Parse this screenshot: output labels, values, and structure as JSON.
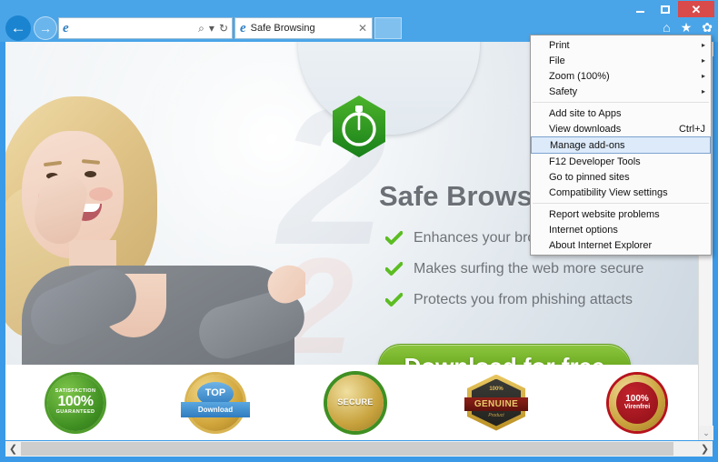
{
  "window": {
    "minimize_label": "",
    "maximize_label": "",
    "close_label": "✕"
  },
  "toolbar": {
    "back_icon": "←",
    "forward_icon": "→",
    "address_value": "",
    "address_placeholder": "",
    "search_icon": "⌕",
    "dropdown_icon": "▾",
    "refresh_icon": "↻",
    "home_icon": "⌂",
    "favorites_icon": "★",
    "tools_icon": "✿"
  },
  "tab": {
    "title": "Safe Browsing",
    "close_label": "✕"
  },
  "menu": {
    "items": [
      {
        "label": "Print",
        "submenu": true,
        "accel": "",
        "selected": false
      },
      {
        "label": "File",
        "submenu": true,
        "accel": "",
        "selected": false
      },
      {
        "label": "Zoom (100%)",
        "submenu": true,
        "accel": "",
        "selected": false
      },
      {
        "label": "Safety",
        "submenu": true,
        "accel": "",
        "selected": false
      },
      {
        "separator": true
      },
      {
        "label": "Add site to Apps",
        "submenu": false,
        "accel": "",
        "selected": false
      },
      {
        "label": "View downloads",
        "submenu": false,
        "accel": "Ctrl+J",
        "selected": false
      },
      {
        "label": "Manage add-ons",
        "submenu": false,
        "accel": "",
        "selected": true
      },
      {
        "label": "F12 Developer Tools",
        "submenu": false,
        "accel": "",
        "selected": false
      },
      {
        "label": "Go to pinned sites",
        "submenu": false,
        "accel": "",
        "selected": false
      },
      {
        "label": "Compatibility View settings",
        "submenu": false,
        "accel": "",
        "selected": false
      },
      {
        "separator": true
      },
      {
        "label": "Report website problems",
        "submenu": false,
        "accel": "",
        "selected": false
      },
      {
        "label": "Internet options",
        "submenu": false,
        "accel": "",
        "selected": false
      },
      {
        "label": "About Internet Explorer",
        "submenu": false,
        "accel": "",
        "selected": false
      }
    ],
    "submenu_arrow": "▸"
  },
  "page": {
    "watermark": "2",
    "headline": "Safe Browsing",
    "bullets": [
      "Enhances your browsing",
      "Makes surfing the web more secure",
      "Protects you from phishing attacts"
    ],
    "download_button": "Download for free",
    "badges": [
      {
        "name": "satisfaction-guaranteed",
        "top": "SATISFACTION",
        "main": "100%",
        "bottom": "GUARANTEED"
      },
      {
        "name": "top-download",
        "top": "TOP",
        "main": "Download",
        "bottom": ""
      },
      {
        "name": "secure",
        "top": "",
        "main": "SECURE",
        "bottom": ""
      },
      {
        "name": "genuine",
        "top": "100%",
        "main": "GENUINE",
        "bottom": "Product"
      },
      {
        "name": "virenfrei",
        "top": "",
        "main": "100%",
        "bottom": "Virenfrei"
      }
    ]
  },
  "scrollbars": {
    "up_icon": "▲",
    "down_icon": "⌄",
    "left_icon": "❮",
    "right_icon": "❯"
  },
  "colors": {
    "chrome_blue": "#4aa5e8",
    "close_red": "#d94a4a",
    "accent_green": "#6aa91f",
    "menu_highlight": "#dceafa"
  }
}
